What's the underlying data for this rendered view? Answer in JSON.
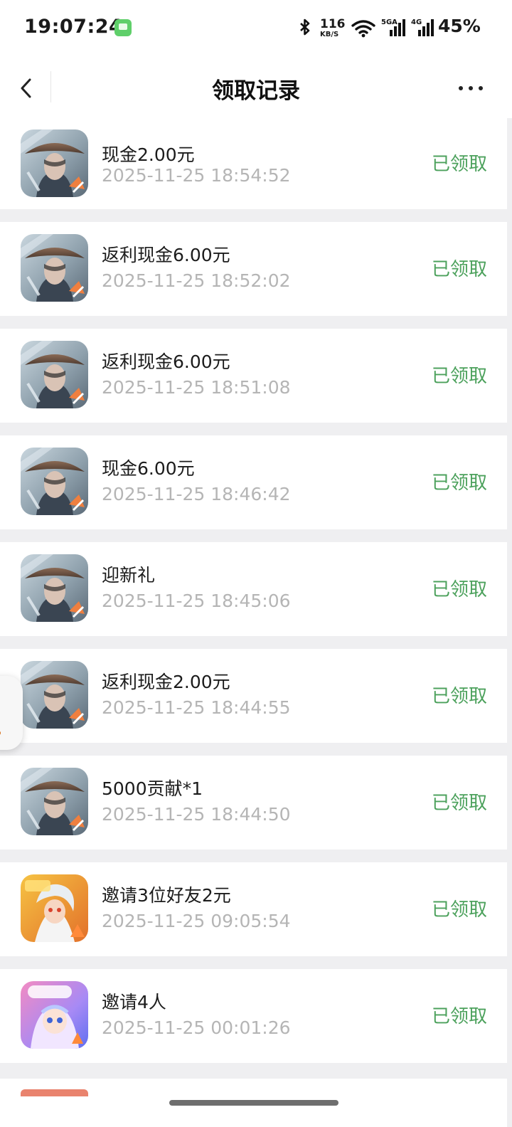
{
  "status_bar": {
    "time": "19:07:24",
    "net_speed_value": "116",
    "net_speed_unit": "KB/S",
    "sim1_label": "5GA",
    "sim2_label": "4G",
    "battery": "45%"
  },
  "nav": {
    "title": "领取记录"
  },
  "records": [
    {
      "title": "现金2.00元",
      "time": "2025-11-25 18:54:52",
      "status": "已领取",
      "icon": "swordsman-game-icon"
    },
    {
      "title": "返利现金6.00元",
      "time": "2025-11-25 18:52:02",
      "status": "已领取",
      "icon": "swordsman-game-icon"
    },
    {
      "title": "返利现金6.00元",
      "time": "2025-11-25 18:51:08",
      "status": "已领取",
      "icon": "swordsman-game-icon"
    },
    {
      "title": "现金6.00元",
      "time": "2025-11-25 18:46:42",
      "status": "已领取",
      "icon": "swordsman-game-icon"
    },
    {
      "title": "迎新礼",
      "time": "2025-11-25 18:45:06",
      "status": "已领取",
      "icon": "swordsman-game-icon"
    },
    {
      "title": "返利现金2.00元",
      "time": "2025-11-25 18:44:55",
      "status": "已领取",
      "icon": "swordsman-game-icon"
    },
    {
      "title": "5000贡献*1",
      "time": "2025-11-25 18:44:50",
      "status": "已领取",
      "icon": "swordsman-game-icon"
    },
    {
      "title": "邀请3位好友2元",
      "time": "2025-11-25 09:05:54",
      "status": "已领取",
      "icon": "anime-hero-game-icon"
    },
    {
      "title": "邀请4人",
      "time": "2025-11-25 00:01:26",
      "status": "已领取",
      "icon": "dance-game-icon"
    }
  ],
  "colors": {
    "status_green": "#4ca15c",
    "timestamp_gray": "#b5b5b5",
    "page_background": "#efeff1"
  }
}
